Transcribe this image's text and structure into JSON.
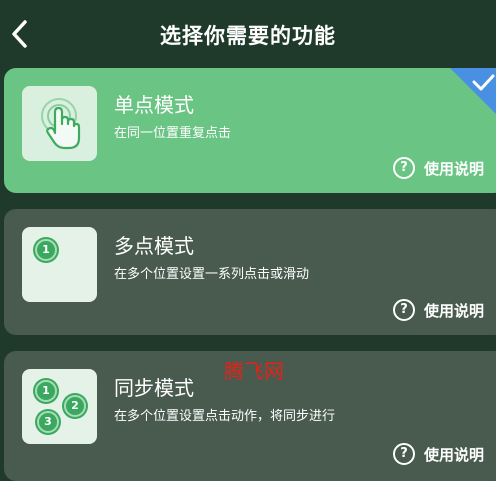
{
  "header": {
    "title": "选择你需要的功能",
    "back_icon": "chevron-left-icon"
  },
  "modes": [
    {
      "title": "单点模式",
      "description": "在同一位置重复点击",
      "help_label": "使用说明",
      "selected": true,
      "icon": "hand-tap-icon"
    },
    {
      "title": "多点模式",
      "description": "在多个位置设置一系列点击或滑动",
      "help_label": "使用说明",
      "selected": false,
      "markers": [
        "1"
      ]
    },
    {
      "title": "同步模式",
      "description": "在多个位置设置点击动作，将同步进行",
      "help_label": "使用说明",
      "selected": false,
      "markers": [
        "1",
        "2",
        "3"
      ]
    }
  ],
  "help_icon_glyph": "?",
  "watermark": "腾飞网",
  "colors": {
    "background": "#1f3a2a",
    "selected_card": "#6ac484",
    "card": "#495a4f",
    "selected_corner": "#4a90e2",
    "marker": "#3aa85e",
    "watermark": "#e2231a"
  }
}
